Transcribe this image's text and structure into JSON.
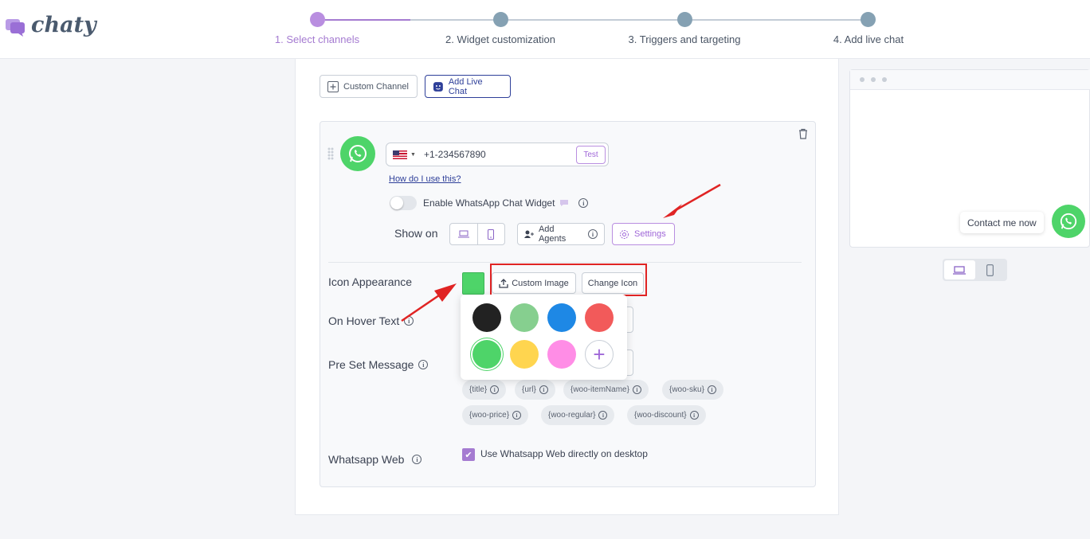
{
  "app": {
    "logo_text": "chaty"
  },
  "steps": [
    {
      "label": "1. Select channels",
      "state": "active"
    },
    {
      "label": "2. Widget customization",
      "state": "inactive"
    },
    {
      "label": "3. Triggers and targeting",
      "state": "inactive"
    },
    {
      "label": "4. Add live chat",
      "state": "inactive"
    }
  ],
  "colors": {
    "accent": "#a57bd1",
    "step_inactive": "#85a1b3",
    "whatsapp": "#4ed469",
    "annotation": "#e02424",
    "live_chat": "#2e3f99"
  },
  "channel_buttons": {
    "custom_channel": "Custom Channel",
    "add_live_chat": "Add Live Chat"
  },
  "whatsapp": {
    "country_flag": "us-flag-icon",
    "phone_value": "+1-234567890",
    "test_label": "Test",
    "help_link": "How do I use this?",
    "enable_widget_label": "Enable WhatsApp Chat Widget",
    "show_on_label": "Show on",
    "add_agents_label": "Add Agents",
    "settings_label": "Settings"
  },
  "icon_appearance": {
    "label": "Icon Appearance",
    "custom_image_label": "Custom Image",
    "change_icon_label": "Change Icon",
    "selected_color": "#4ed469",
    "palette": [
      "#222222",
      "#86cf8f",
      "#1e88e5",
      "#f25a5a",
      "#4ed469",
      "#ffd54f",
      "#ff8de6"
    ]
  },
  "on_hover_text": {
    "label": "On Hover Text"
  },
  "pre_set_message": {
    "label": "Pre Set Message",
    "tags": [
      "{title}",
      "{url}",
      "{woo-itemName}",
      "{woo-sku}",
      "{woo-price}",
      "{woo-regular}",
      "{woo-discount}"
    ]
  },
  "whatsapp_web": {
    "label": "Whatsapp Web",
    "checkbox_label": "Use Whatsapp Web directly on desktop",
    "checked": true
  },
  "preview": {
    "bubble_text": "Contact me now"
  }
}
